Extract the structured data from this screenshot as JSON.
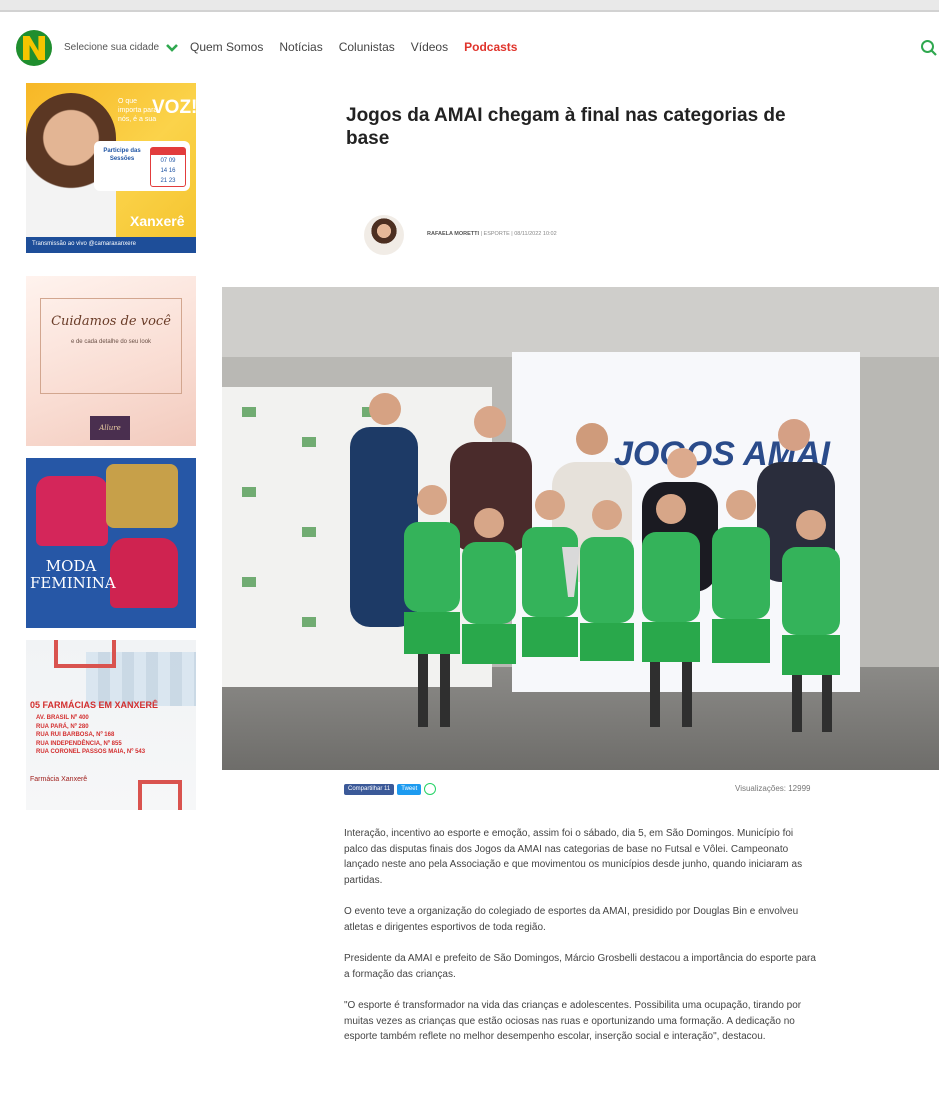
{
  "header": {
    "city_selector": "Selecione sua cidade",
    "nav": [
      "Quem Somos",
      "Notícias",
      "Colunistas",
      "Vídeos",
      "Podcasts"
    ]
  },
  "ads": {
    "ad1": {
      "question": "O que importa para nós, é a sua",
      "headline": "VOZ!",
      "card_text": "Participe das Sessões",
      "calendar": [
        "07",
        "09",
        "14",
        "16",
        "21",
        "23"
      ],
      "brand": "Xanxerê",
      "footer": "Transmissão ao vivo  @camaraxanxere"
    },
    "ad2": {
      "headline": "Cuidamos de você",
      "text": "e de cada detalhe do seu look",
      "logo": "Allure"
    },
    "ad3": {
      "headline": "MODA FEMININA"
    },
    "ad4": {
      "headline": "05 FARMÁCIAS EM XANXERÊ",
      "addresses": [
        "AV. BRASIL Nº 400",
        "RUA PARÁ, Nº 280",
        "RUA RUI BARBOSA, Nº 168",
        "RUA INDEPENDÊNCIA, Nº 855",
        "RUA CORONEL PASSOS MAIA, Nº 543"
      ],
      "brand": "Farmácia Xanxerê"
    }
  },
  "article": {
    "title": "Jogos da AMAI chegam à final nas categorias de base",
    "author": "RAFAELA MORETTI",
    "category": "ESPORTE",
    "date": "08/11/2022 10:02",
    "banner_text": "JOGOS AMAI",
    "share_facebook": "Compartilhar 11",
    "share_twitter": "Tweet",
    "views": "Visualizações: 12999",
    "paragraphs": [
      "Interação, incentivo ao esporte e emoção, assim foi o sábado, dia 5, em São Domingos. Município foi palco das disputas finais dos Jogos da AMAI nas categorias de base no Futsal e Vôlei. Campeonato lançado neste ano pela Associação e que movimentou os municípios desde junho, quando iniciaram as partidas.",
      "O evento teve a organização do colegiado de esportes da AMAI, presidido por Douglas Bin e envolveu atletas e dirigentes esportivos de toda região.",
      "Presidente da AMAI e prefeito de São Domingos, Márcio Grosbelli destacou a importância do esporte para a formação das crianças.",
      "\"O esporte é transformador na vida das crianças e adolescentes. Possibilita uma ocupação, tirando por muitas vezes as crianças que estão ociosas nas ruas e oportunizando uma formação. A dedicação no esporte também reflete no melhor desempenho escolar, inserção social e interação\", destacou."
    ]
  },
  "colors": {
    "brand_green": "#1f8e2e",
    "brand_yellow": "#f4c500",
    "podcasts_red": "#e0342c",
    "search_green": "#2fa84f"
  }
}
